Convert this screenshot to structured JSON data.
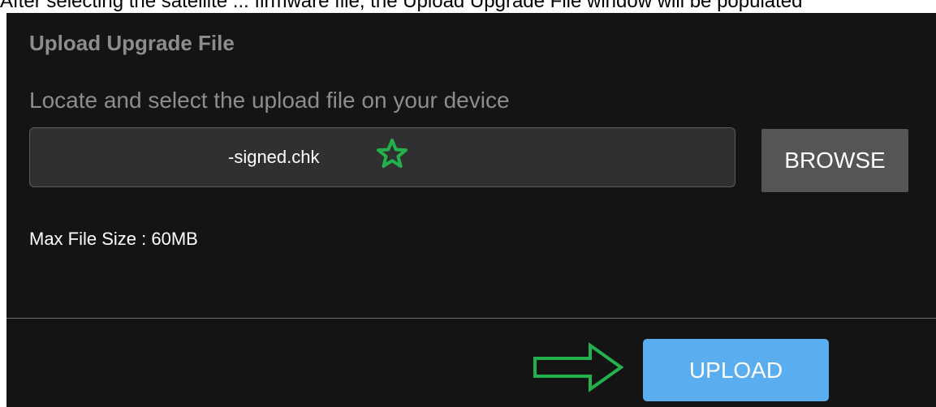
{
  "caption": "After selecting the satellite ... firmware file, the Upload Upgrade File window will be populated",
  "dialog": {
    "title": "Upload Upgrade File",
    "instruction": "Locate and select the upload file on your device",
    "file_name": "-signed.chk",
    "browse_label": "BROWSE",
    "max_size": "Max File Size : 60MB",
    "upload_label": "UPLOAD"
  },
  "annotations": {
    "star_icon": "star-icon",
    "arrow_icon": "arrow-right-icon",
    "color": "#22b14c"
  },
  "colors": {
    "dialog_bg": "#141414",
    "field_bg": "#303030",
    "browse_bg": "#555555",
    "upload_bg": "#5aadee"
  }
}
